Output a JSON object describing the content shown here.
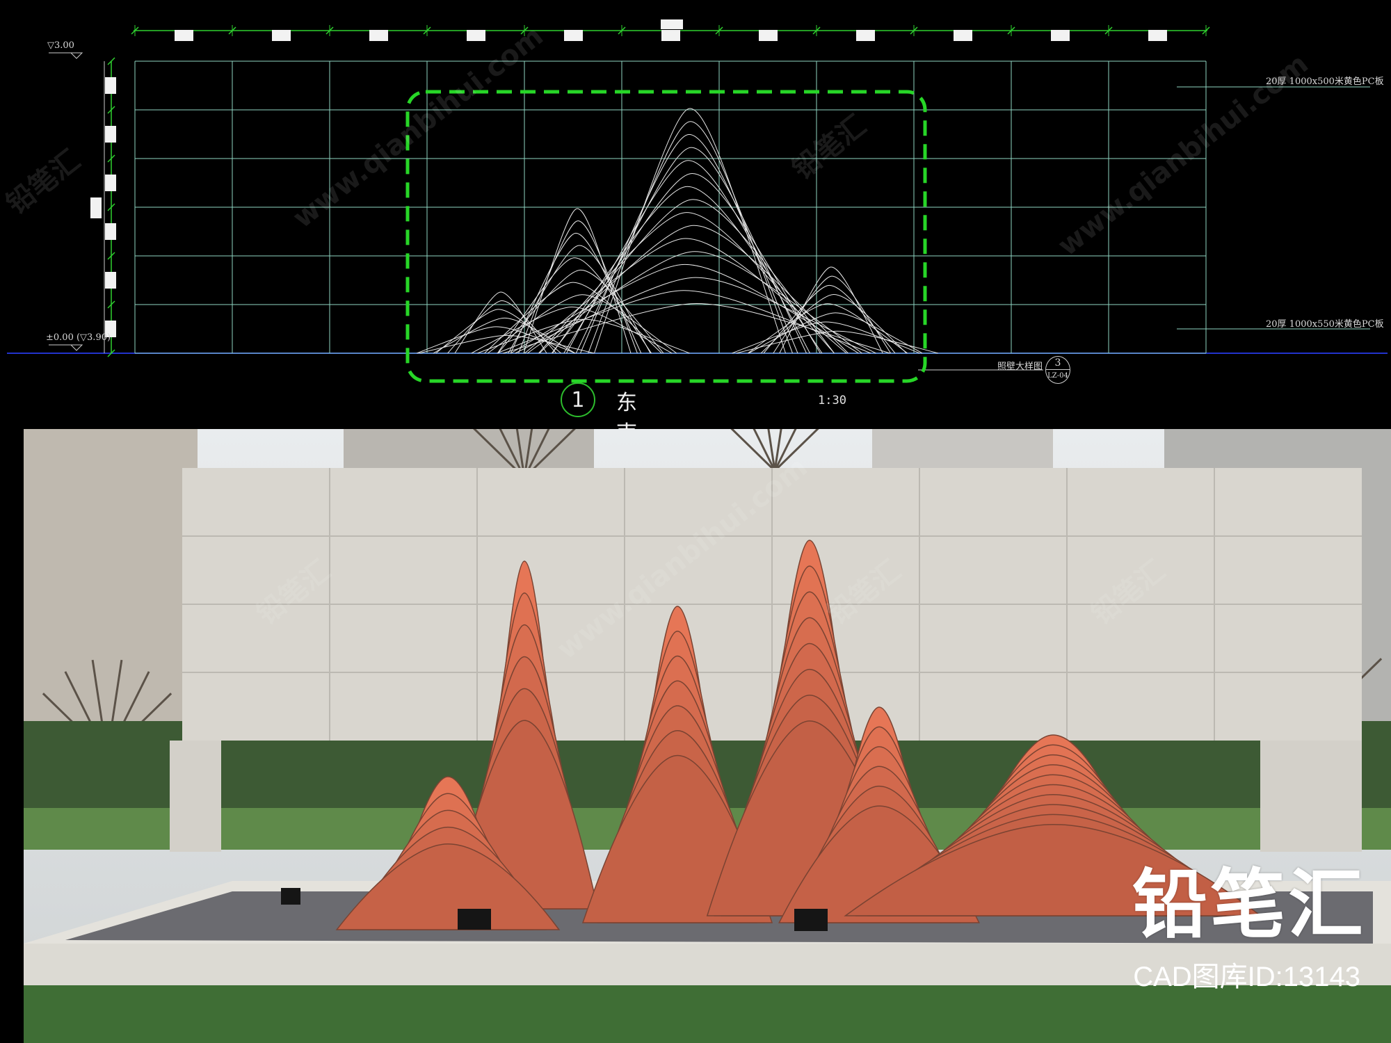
{
  "drawing": {
    "title_number": "1",
    "title": "东南入口照壁立面图一",
    "scale": "1:30",
    "level_top": "▽3.00",
    "level_bottom": "±0.00 (▽3.90)",
    "annotation_top": "20厚 1000x500米黄色PC板",
    "annotation_bottom": "20厚 1000x550米黄色PC板",
    "detail_ref_label": "照壁大样图",
    "detail_ref_number": "3",
    "detail_ref_sheet": "LZ-04",
    "colors": {
      "dimension_line": "#2fd12f",
      "grid_line": "#8fd6c2",
      "highlight_dash": "#27d627",
      "ground_line": "#2233cc",
      "sculpture_line": "#e8e8e8"
    }
  },
  "photo": {
    "brand": "铅笔汇",
    "brand_id": "CAD图库ID:13143",
    "colors": {
      "wall": "#d9d6cf",
      "sculpture": "#b9735a",
      "gravel": "#6b6b70",
      "grass": "#3f6e35"
    }
  },
  "watermarks": [
    "铅笔汇",
    "www.qianbihui.com"
  ]
}
